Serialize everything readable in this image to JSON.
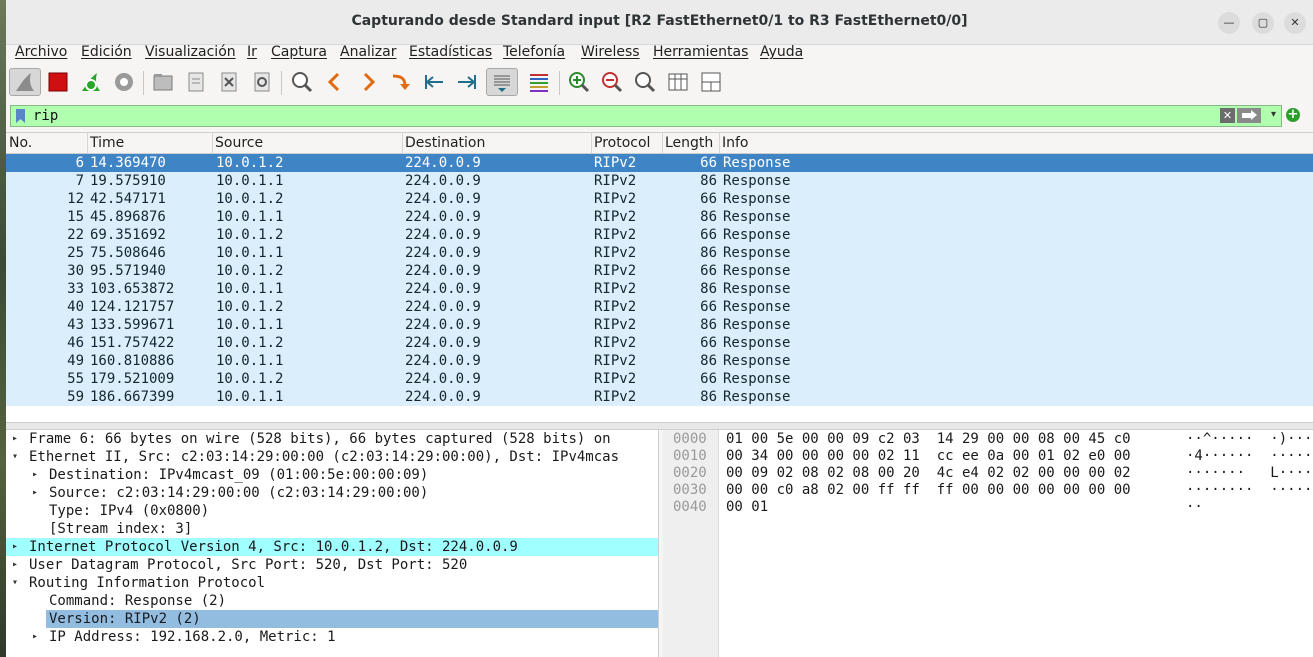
{
  "window": {
    "title": "Capturando desde Standard input [R2 FastEthernet0/1 to R3 FastEthernet0/0]"
  },
  "menu": [
    "Archivo",
    "Edición",
    "Visualización",
    "Ir",
    "Captura",
    "Analizar",
    "Estadísticas",
    "Telefonía",
    "Wireless",
    "Herramientas",
    "Ayuda"
  ],
  "filter": {
    "value": "rip"
  },
  "columns": [
    "No.",
    "Time",
    "Source",
    "Destination",
    "Protocol",
    "Length",
    "Info"
  ],
  "packets": [
    {
      "no": "6",
      "time": "14.369470",
      "src": "10.0.1.2",
      "dst": "224.0.0.9",
      "proto": "RIPv2",
      "len": "66",
      "info": "Response"
    },
    {
      "no": "7",
      "time": "19.575910",
      "src": "10.0.1.1",
      "dst": "224.0.0.9",
      "proto": "RIPv2",
      "len": "86",
      "info": "Response"
    },
    {
      "no": "12",
      "time": "42.547171",
      "src": "10.0.1.2",
      "dst": "224.0.0.9",
      "proto": "RIPv2",
      "len": "66",
      "info": "Response"
    },
    {
      "no": "15",
      "time": "45.896876",
      "src": "10.0.1.1",
      "dst": "224.0.0.9",
      "proto": "RIPv2",
      "len": "86",
      "info": "Response"
    },
    {
      "no": "22",
      "time": "69.351692",
      "src": "10.0.1.2",
      "dst": "224.0.0.9",
      "proto": "RIPv2",
      "len": "66",
      "info": "Response"
    },
    {
      "no": "25",
      "time": "75.508646",
      "src": "10.0.1.1",
      "dst": "224.0.0.9",
      "proto": "RIPv2",
      "len": "86",
      "info": "Response"
    },
    {
      "no": "30",
      "time": "95.571940",
      "src": "10.0.1.2",
      "dst": "224.0.0.9",
      "proto": "RIPv2",
      "len": "66",
      "info": "Response"
    },
    {
      "no": "33",
      "time": "103.653872",
      "src": "10.0.1.1",
      "dst": "224.0.0.9",
      "proto": "RIPv2",
      "len": "86",
      "info": "Response"
    },
    {
      "no": "40",
      "time": "124.121757",
      "src": "10.0.1.2",
      "dst": "224.0.0.9",
      "proto": "RIPv2",
      "len": "66",
      "info": "Response"
    },
    {
      "no": "43",
      "time": "133.599671",
      "src": "10.0.1.1",
      "dst": "224.0.0.9",
      "proto": "RIPv2",
      "len": "86",
      "info": "Response"
    },
    {
      "no": "46",
      "time": "151.757422",
      "src": "10.0.1.2",
      "dst": "224.0.0.9",
      "proto": "RIPv2",
      "len": "66",
      "info": "Response"
    },
    {
      "no": "49",
      "time": "160.810886",
      "src": "10.0.1.1",
      "dst": "224.0.0.9",
      "proto": "RIPv2",
      "len": "86",
      "info": "Response"
    },
    {
      "no": "55",
      "time": "179.521009",
      "src": "10.0.1.2",
      "dst": "224.0.0.9",
      "proto": "RIPv2",
      "len": "66",
      "info": "Response"
    },
    {
      "no": "59",
      "time": "186.667399",
      "src": "10.0.1.1",
      "dst": "224.0.0.9",
      "proto": "RIPv2",
      "len": "86",
      "info": "Response"
    }
  ],
  "details": [
    {
      "text": "Frame 6: 66 bytes on wire (528 bits), 66 bytes captured (528 bits) on",
      "arrow": "▸",
      "level": 0
    },
    {
      "text": "Ethernet II, Src: c2:03:14:29:00:00 (c2:03:14:29:00:00), Dst: IPv4mcas",
      "arrow": "▾",
      "level": 0
    },
    {
      "text": "Destination: IPv4mcast_09 (01:00:5e:00:00:09)",
      "arrow": "▸",
      "level": 1
    },
    {
      "text": "Source: c2:03:14:29:00:00 (c2:03:14:29:00:00)",
      "arrow": "▸",
      "level": 1
    },
    {
      "text": "Type: IPv4 (0x0800)",
      "arrow": "",
      "level": 1
    },
    {
      "text": "[Stream index: 3]",
      "arrow": "",
      "level": 1
    },
    {
      "text": "Internet Protocol Version 4, Src: 10.0.1.2, Dst: 224.0.0.9",
      "arrow": "▸",
      "level": 0
    },
    {
      "text": "User Datagram Protocol, Src Port: 520, Dst Port: 520",
      "arrow": "▸",
      "level": 0
    },
    {
      "text": "Routing Information Protocol",
      "arrow": "▾",
      "level": 0
    },
    {
      "text": "Command: Response (2)",
      "arrow": "",
      "level": 1
    },
    {
      "text": "Version: RIPv2 (2)",
      "arrow": "",
      "level": 1
    },
    {
      "text": "IP Address: 192.168.2.0, Metric: 1",
      "arrow": "▸",
      "level": 1
    }
  ],
  "hex": [
    {
      "off": "0000",
      "bytes": "01 00 5e 00 00 09 c2 03  14 29 00 00 08 00 45 c0",
      "ascii": "··^·····  ·)····"
    },
    {
      "off": "0010",
      "bytes": "00 34 00 00 00 00 02 11  cc ee 0a 00 01 02 e0 00",
      "ascii": "·4······  ······"
    },
    {
      "off": "0020",
      "bytes": "00 09 02 08 02 08 00 20  4c e4 02 02 00 00 00 02",
      "ascii": "·······   L·····"
    },
    {
      "off": "0030",
      "bytes": "00 00 c0 a8 02 00 ff ff  ff 00 00 00 00 00 00 00",
      "ascii": "········  ······"
    },
    {
      "off": "0040",
      "bytes": "00 01",
      "ascii": "··"
    }
  ]
}
